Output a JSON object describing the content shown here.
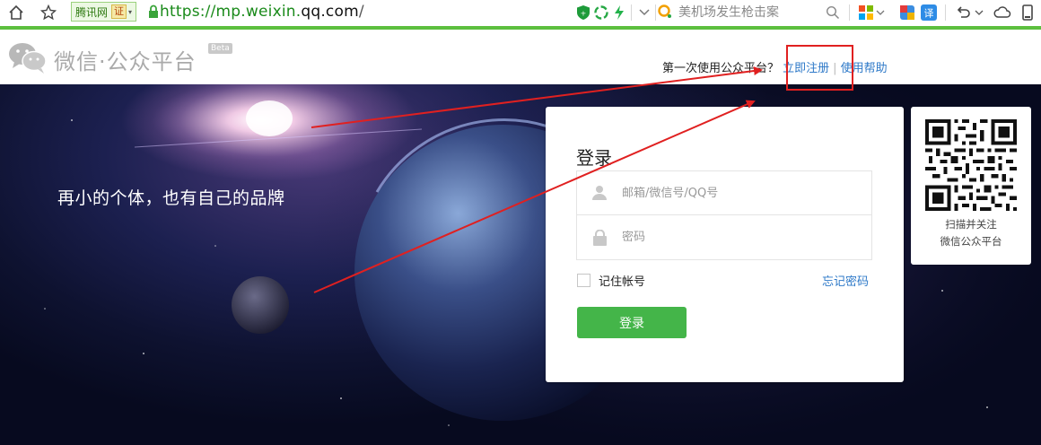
{
  "browser": {
    "site_badge": "腾讯网",
    "cert_badge": "证",
    "url_highlight": "https://mp.weixin.",
    "url_domain": "qq.com",
    "url_rest": "/",
    "search_placeholder": "美机场发生枪击案",
    "translate_label": "译"
  },
  "header": {
    "logo_text": "微信·公众平台",
    "beta_label": "Beta",
    "first_time_text": "第一次使用公众平台？",
    "register_link": "立即注册",
    "separator": "|",
    "help_link": "使用帮助"
  },
  "hero": {
    "slogan": "再小的个体，也有自己的品牌"
  },
  "login": {
    "title": "登录",
    "account_placeholder": "邮箱/微信号/QQ号",
    "password_placeholder": "密码",
    "remember_label": "记住帐号",
    "forgot_link": "忘记密码",
    "submit_label": "登录"
  },
  "qr": {
    "caption_line1": "扫描并关注",
    "caption_line2": "微信公众平台"
  },
  "colors": {
    "accent_green": "#44b549",
    "link_blue": "#2e79c8",
    "annotation_red": "#e02020",
    "browser_accent": "#5cbf3e"
  },
  "icons": [
    "home-icon",
    "star-icon",
    "lock-icon",
    "shield-icon",
    "flash-icon",
    "search-icon",
    "undo-icon",
    "cloud-icon",
    "wechat-logo-icon",
    "user-icon",
    "lock-field-icon"
  ]
}
